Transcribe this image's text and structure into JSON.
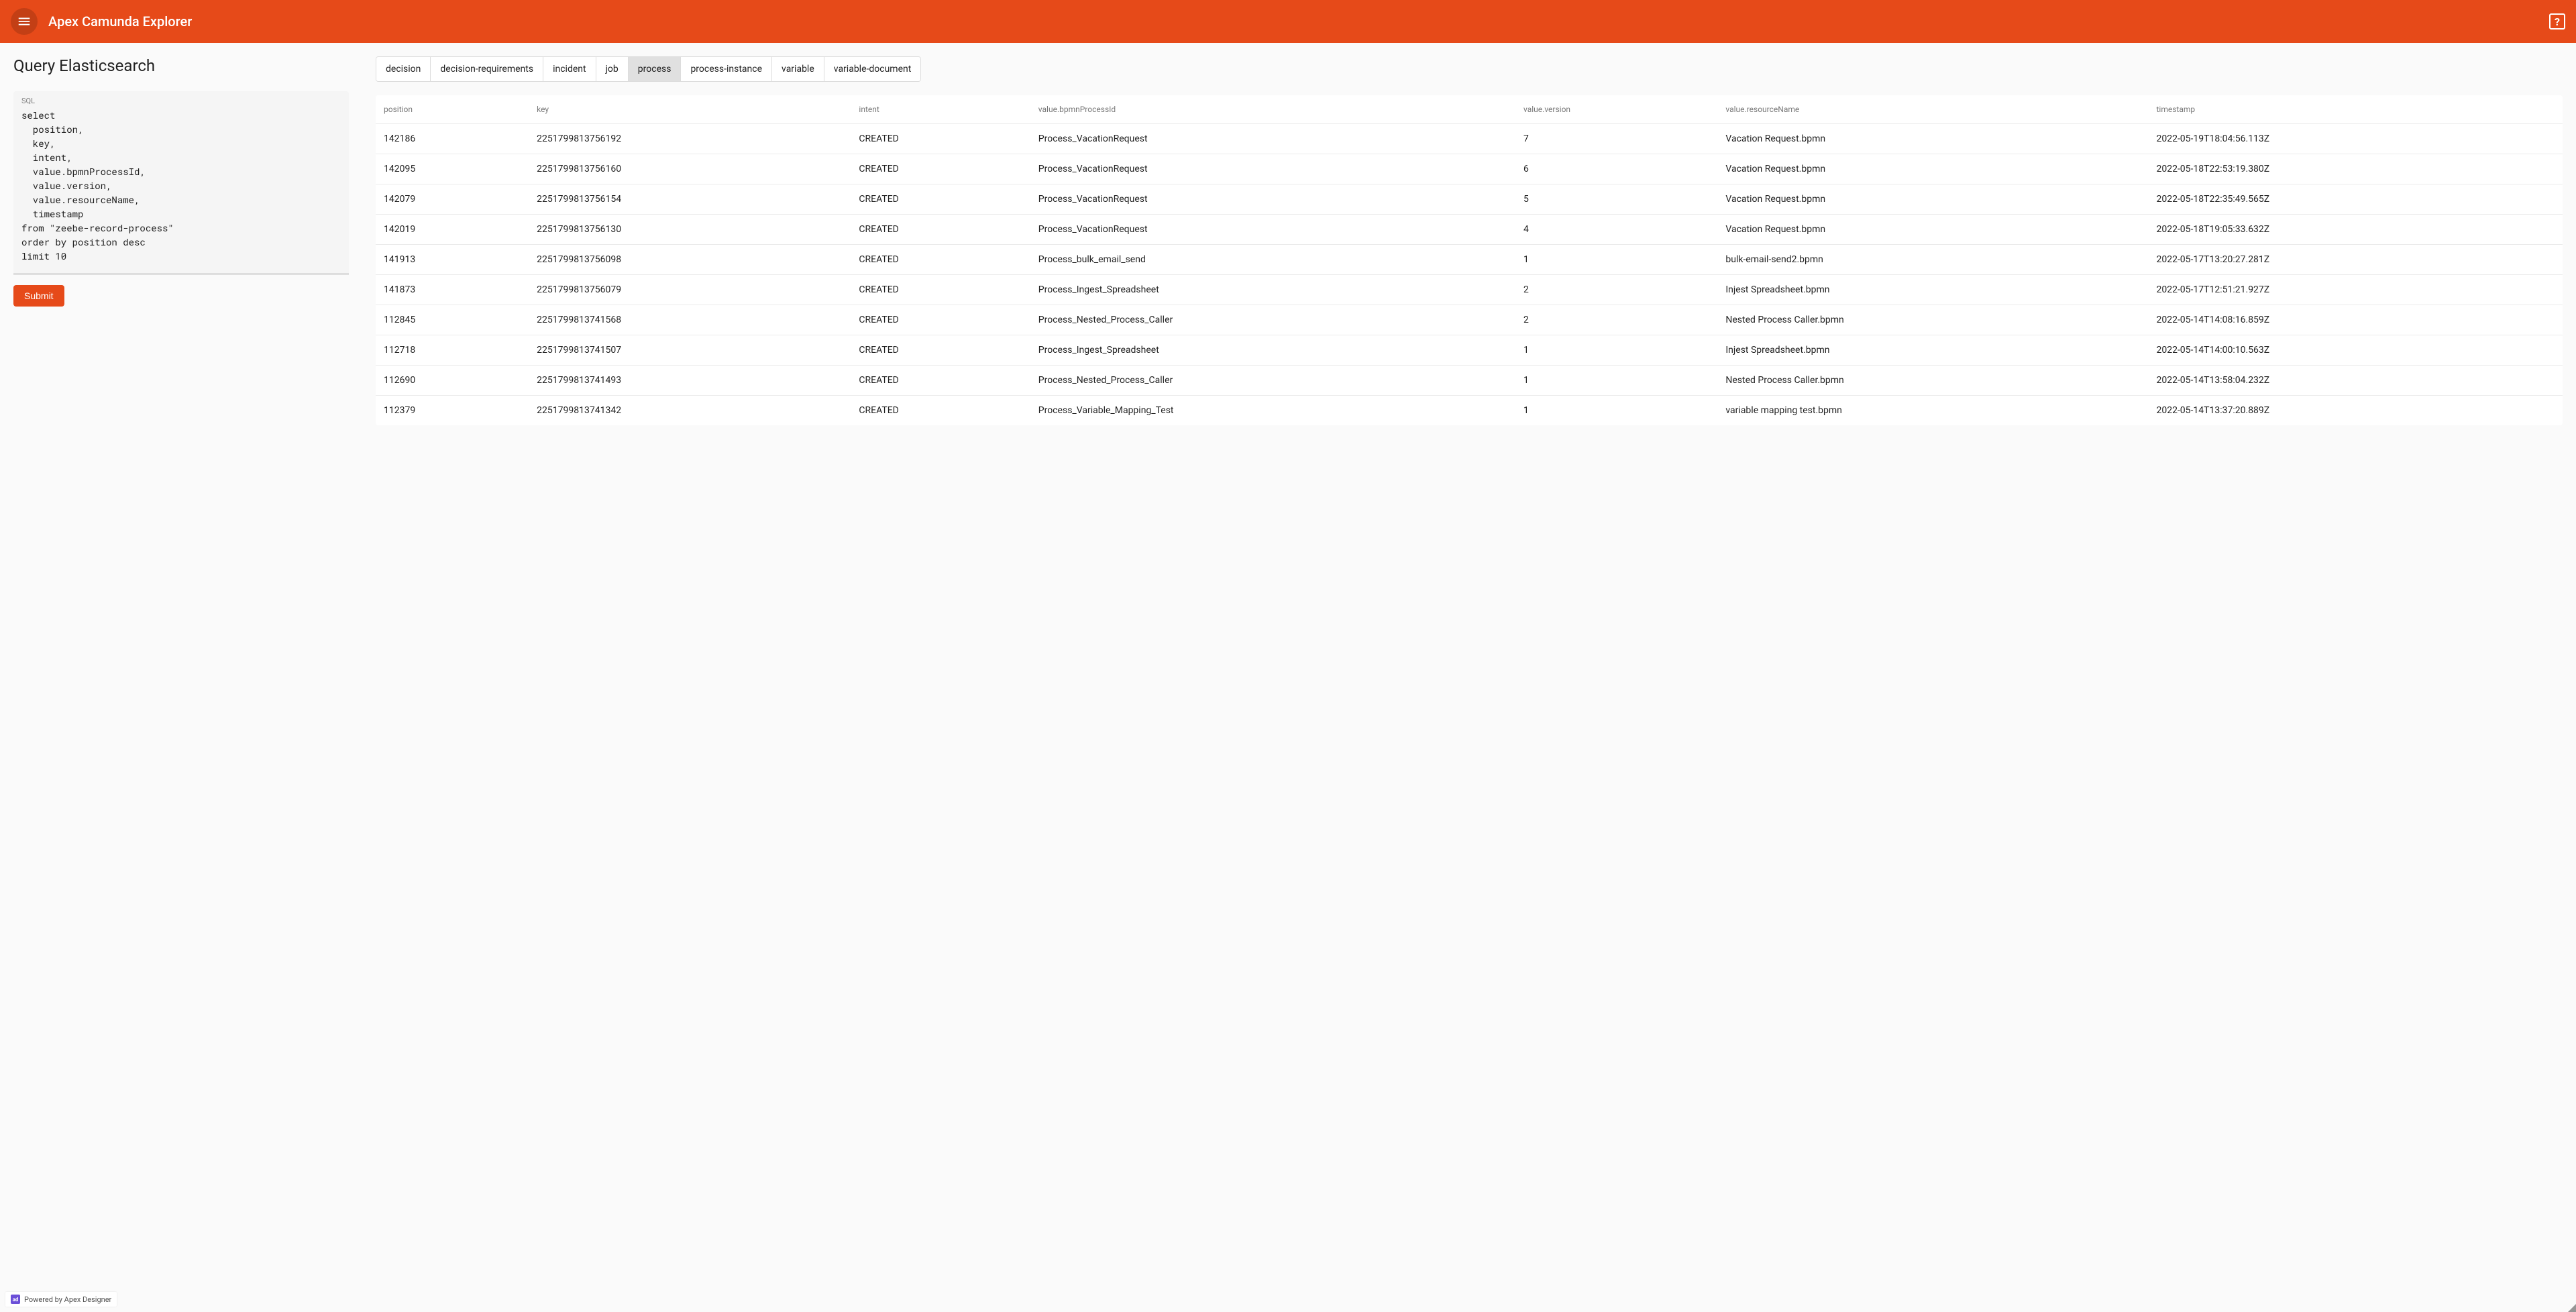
{
  "header": {
    "title": "Apex Camunda Explorer",
    "help_glyph": "?"
  },
  "page": {
    "title": "Query Elasticsearch"
  },
  "sql": {
    "label": "SQL",
    "value": "select\n  position,\n  key,\n  intent,\n  value.bpmnProcessId,\n  value.version,\n  value.resourceName,\n  timestamp\nfrom \"zeebe-record-process\"\norder by position desc\nlimit 10",
    "submit_label": "Submit"
  },
  "tabs": [
    {
      "label": "decision",
      "active": false
    },
    {
      "label": "decision-requirements",
      "active": false
    },
    {
      "label": "incident",
      "active": false
    },
    {
      "label": "job",
      "active": false
    },
    {
      "label": "process",
      "active": true
    },
    {
      "label": "process-instance",
      "active": false
    },
    {
      "label": "variable",
      "active": false
    },
    {
      "label": "variable-document",
      "active": false
    }
  ],
  "table": {
    "columns": [
      "position",
      "key",
      "intent",
      "value.bpmnProcessId",
      "value.version",
      "value.resourceName",
      "timestamp"
    ],
    "rows": [
      [
        "142186",
        "2251799813756192",
        "CREATED",
        "Process_VacationRequest",
        "7",
        "Vacation Request.bpmn",
        "2022-05-19T18:04:56.113Z"
      ],
      [
        "142095",
        "2251799813756160",
        "CREATED",
        "Process_VacationRequest",
        "6",
        "Vacation Request.bpmn",
        "2022-05-18T22:53:19.380Z"
      ],
      [
        "142079",
        "2251799813756154",
        "CREATED",
        "Process_VacationRequest",
        "5",
        "Vacation Request.bpmn",
        "2022-05-18T22:35:49.565Z"
      ],
      [
        "142019",
        "2251799813756130",
        "CREATED",
        "Process_VacationRequest",
        "4",
        "Vacation Request.bpmn",
        "2022-05-18T19:05:33.632Z"
      ],
      [
        "141913",
        "2251799813756098",
        "CREATED",
        "Process_bulk_email_send",
        "1",
        "bulk-email-send2.bpmn",
        "2022-05-17T13:20:27.281Z"
      ],
      [
        "141873",
        "2251799813756079",
        "CREATED",
        "Process_Ingest_Spreadsheet",
        "2",
        "Injest Spreadsheet.bpmn",
        "2022-05-17T12:51:21.927Z"
      ],
      [
        "112845",
        "2251799813741568",
        "CREATED",
        "Process_Nested_Process_Caller",
        "2",
        "Nested Process Caller.bpmn",
        "2022-05-14T14:08:16.859Z"
      ],
      [
        "112718",
        "2251799813741507",
        "CREATED",
        "Process_Ingest_Spreadsheet",
        "1",
        "Injest Spreadsheet.bpmn",
        "2022-05-14T14:00:10.563Z"
      ],
      [
        "112690",
        "2251799813741493",
        "CREATED",
        "Process_Nested_Process_Caller",
        "1",
        "Nested Process Caller.bpmn",
        "2022-05-14T13:58:04.232Z"
      ],
      [
        "112379",
        "2251799813741342",
        "CREATED",
        "Process_Variable_Mapping_Test",
        "1",
        "variable mapping test.bpmn",
        "2022-05-14T13:37:20.889Z"
      ]
    ]
  },
  "footer": {
    "icon_glyph": "ad",
    "text": "Powered by Apex Designer"
  }
}
